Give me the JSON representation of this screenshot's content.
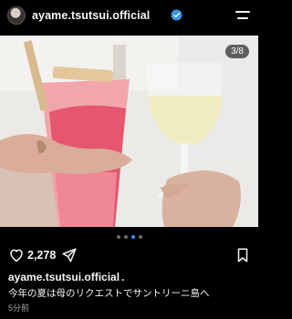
{
  "header": {
    "username": "ayame.tsutsui.official"
  },
  "post": {
    "counter": "3/8",
    "carousel": {
      "current": 3,
      "total": 8
    }
  },
  "actions": {
    "likes": "2,278"
  },
  "caption": {
    "username": "ayame.tsutsui.official",
    "separator": ".",
    "text": "今年の夏は母のリクエストでサントリーニ島へ",
    "timestamp": "5分前"
  },
  "colors": {
    "verified": "#3897f0",
    "active_dot": "#3b8ff6",
    "muted_text": "#a8a8a8"
  },
  "icons": [
    "menu-icon",
    "verified-icon",
    "heart-icon",
    "share-icon",
    "bookmark-icon"
  ]
}
